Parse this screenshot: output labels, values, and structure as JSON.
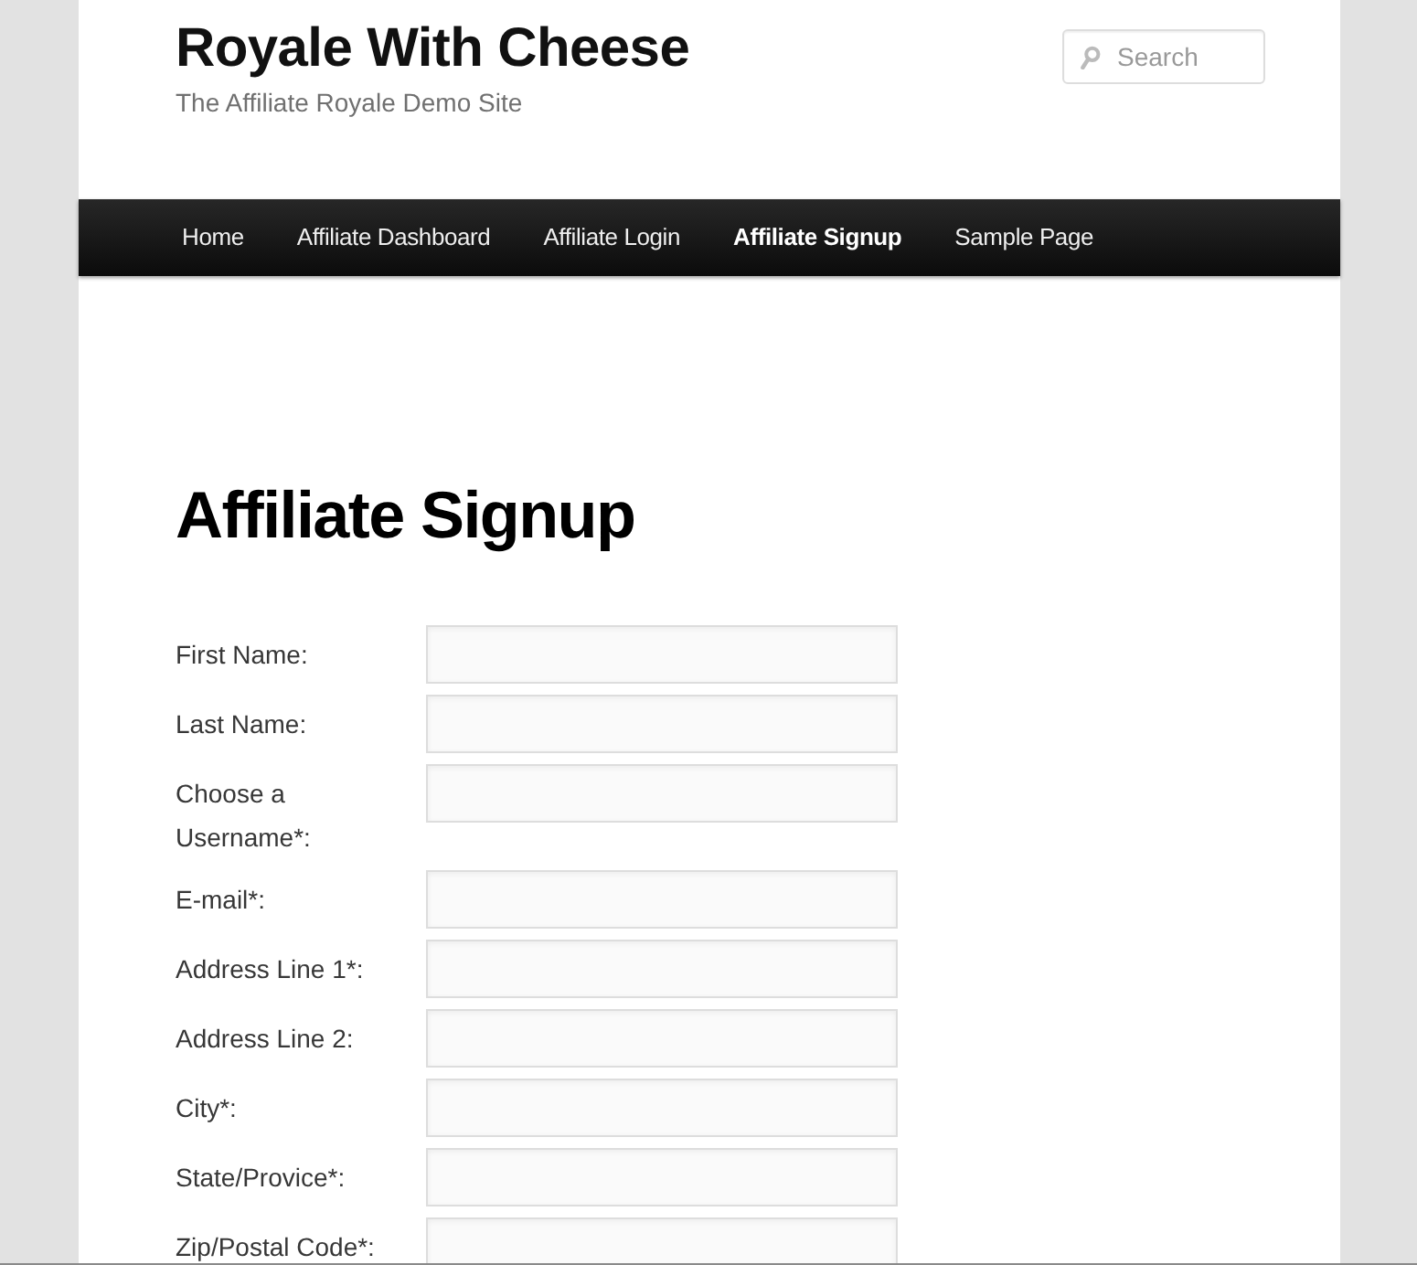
{
  "site": {
    "title": "Royale With Cheese",
    "tagline": "The Affiliate Royale Demo Site"
  },
  "search": {
    "placeholder": "Search"
  },
  "nav": [
    {
      "label": "Home",
      "selected": false
    },
    {
      "label": "Affiliate Dashboard",
      "selected": false
    },
    {
      "label": "Affiliate Login",
      "selected": false
    },
    {
      "label": "Affiliate Signup",
      "selected": true
    },
    {
      "label": "Sample Page",
      "selected": false
    }
  ],
  "page": {
    "title": "Affiliate Signup"
  },
  "form": {
    "fields": [
      {
        "label": "First Name:"
      },
      {
        "label": "Last Name:"
      },
      {
        "label": "Choose a Username*:"
      },
      {
        "label": "E-mail*:"
      },
      {
        "label": "Address Line 1*:"
      },
      {
        "label": "Address Line 2:"
      },
      {
        "label": "City*:"
      },
      {
        "label": "State/Provice*:"
      },
      {
        "label": "Zip/Postal Code*:"
      }
    ]
  }
}
